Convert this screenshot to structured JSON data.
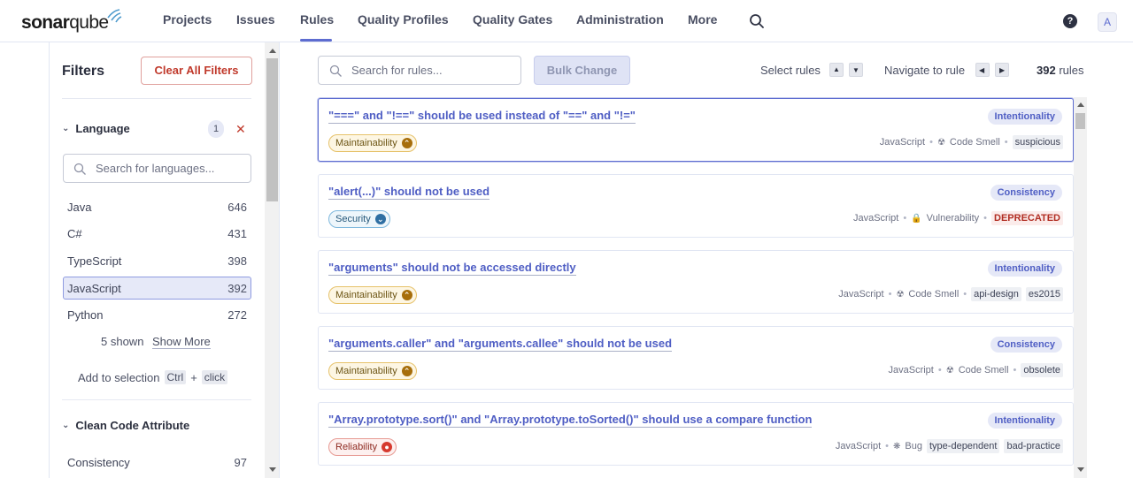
{
  "brand": {
    "word1": "sonar",
    "word2": "qube"
  },
  "nav": {
    "items": [
      "Projects",
      "Issues",
      "Rules",
      "Quality Profiles",
      "Quality Gates",
      "Administration",
      "More"
    ],
    "active": "Rules",
    "avatar": "A",
    "help": "?"
  },
  "filters": {
    "title": "Filters",
    "clear_label": "Clear All Filters",
    "language": {
      "label": "Language",
      "selected_count": "1",
      "search_placeholder": "Search for languages...",
      "items": [
        {
          "name": "Java",
          "count": "646"
        },
        {
          "name": "C#",
          "count": "431"
        },
        {
          "name": "TypeScript",
          "count": "398"
        },
        {
          "name": "JavaScript",
          "count": "392",
          "selected": true
        },
        {
          "name": "Python",
          "count": "272"
        }
      ],
      "shown_text": "5 shown",
      "show_more": "Show More",
      "add_selection": "Add to selection",
      "kbd_ctrl": "Ctrl",
      "kbd_plus": "+",
      "kbd_click": "click"
    },
    "clean_code": {
      "label": "Clean Code Attribute",
      "items": [
        {
          "name": "Consistency",
          "count": "97"
        }
      ]
    }
  },
  "toolbar": {
    "search_placeholder": "Search for rules...",
    "bulk_label": "Bulk Change",
    "select_rules": "Select rules",
    "navigate_rule": "Navigate to rule",
    "total_count": "392",
    "total_suffix": " rules"
  },
  "rules": [
    {
      "title": "\"===\" and \"!==\" should be used instead of \"==\" and \"!=\"",
      "attribute": "Intentionality",
      "quality": "Maintainability",
      "quality_kind": "maint",
      "language": "JavaScript",
      "type": "Code Smell",
      "type_icon": "code-smell-icon",
      "tags": [
        "suspicious"
      ],
      "focused": true
    },
    {
      "title": "\"alert(...)\" should not be used",
      "attribute": "Consistency",
      "quality": "Security",
      "quality_kind": "sec",
      "language": "JavaScript",
      "type": "Vulnerability",
      "type_icon": "lock-icon",
      "tags": [
        "DEPRECATED"
      ],
      "deprecated": true
    },
    {
      "title": "\"arguments\" should not be accessed directly",
      "attribute": "Intentionality",
      "quality": "Maintainability",
      "quality_kind": "maint",
      "language": "JavaScript",
      "type": "Code Smell",
      "type_icon": "code-smell-icon",
      "tags": [
        "api-design",
        "es2015"
      ]
    },
    {
      "title": "\"arguments.caller\" and \"arguments.callee\" should not be used",
      "attribute": "Consistency",
      "quality": "Maintainability",
      "quality_kind": "maint",
      "language": "JavaScript",
      "type": "Code Smell",
      "type_icon": "code-smell-icon",
      "tags": [
        "obsolete"
      ]
    },
    {
      "title": "\"Array.prototype.sort()\" and \"Array.prototype.toSorted()\" should use a compare function",
      "attribute": "Intentionality",
      "quality": "Reliability",
      "quality_kind": "rel",
      "language": "JavaScript",
      "type": "Bug",
      "type_icon": "bug-icon",
      "tags": [
        "type-dependent",
        "bad-practice"
      ]
    }
  ]
}
